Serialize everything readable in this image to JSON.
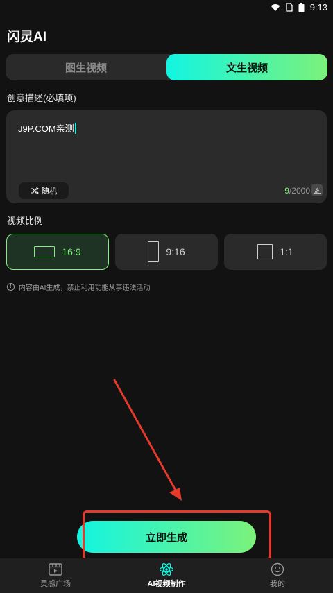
{
  "status_bar": {
    "time": "9:13"
  },
  "header": {
    "title": "闪灵AI"
  },
  "tabs": [
    {
      "label": "图生视频",
      "active": false
    },
    {
      "label": "文生视频",
      "active": true
    }
  ],
  "prompt": {
    "label": "创意描述(必填项)",
    "value": "J9P.COM亲测",
    "random_label": "随机",
    "count_current": "9",
    "count_max": "/2000"
  },
  "ratio": {
    "label": "视频比例",
    "options": [
      {
        "label": "16:9",
        "selected": true
      },
      {
        "label": "9:16",
        "selected": false
      },
      {
        "label": "1:1",
        "selected": false
      }
    ]
  },
  "notice": "内容由AI生成，禁止利用功能从事违法活动",
  "generate_button": "立即生成",
  "bottom_nav": [
    {
      "label": "灵感广场",
      "icon": "film-icon",
      "active": false
    },
    {
      "label": "AI视频制作",
      "icon": "atom-icon",
      "active": true
    },
    {
      "label": "我的",
      "icon": "smile-icon",
      "active": false
    }
  ],
  "colors": {
    "accent_start": "#12f5e2",
    "accent_end": "#7cf27a",
    "background": "#121212",
    "annotation": "#e33a2b"
  }
}
